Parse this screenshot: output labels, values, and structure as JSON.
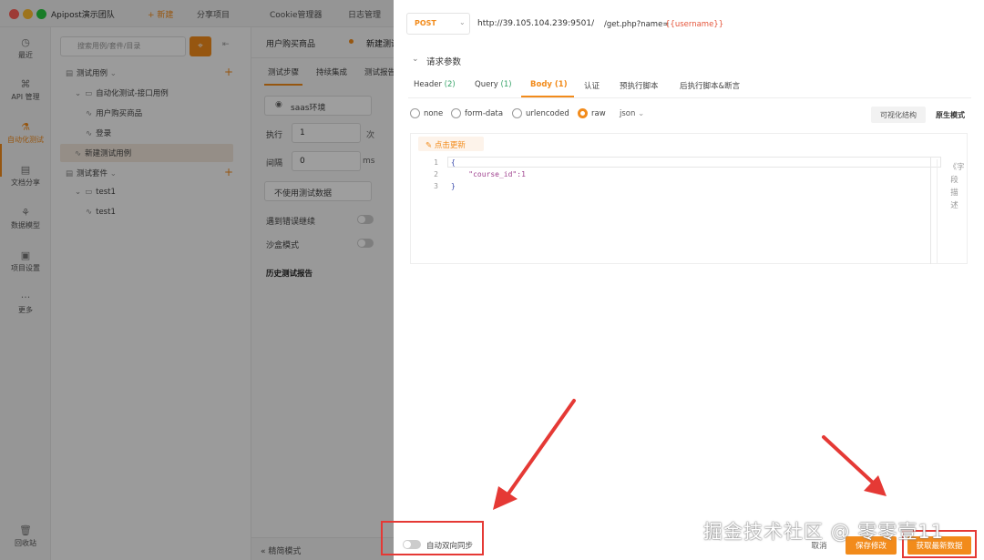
{
  "titlebar": {
    "team": "Apipost演示团队",
    "new_label": "+ 新建",
    "share_label": "分享项目",
    "cookie_label": "Cookie管理器",
    "log_label": "日志管理"
  },
  "nav": {
    "items": [
      {
        "label": "最近",
        "icon": "clock-icon"
      },
      {
        "label": "API 管理",
        "icon": "api-icon"
      },
      {
        "label": "自动化测试",
        "icon": "flask-icon"
      },
      {
        "label": "文档分享",
        "icon": "document-icon"
      },
      {
        "label": "数据模型",
        "icon": "cube-icon"
      },
      {
        "label": "项目设置",
        "icon": "settings-icon"
      },
      {
        "label": "更多",
        "icon": "more-icon"
      },
      {
        "label": "回收站",
        "icon": "trash-icon"
      }
    ]
  },
  "tree": {
    "search_placeholder": "搜索用例/套件/目录",
    "nodes": [
      {
        "label": "测试用例"
      },
      {
        "label": "自动化测试-接口用例"
      },
      {
        "label": "用户购买商品"
      },
      {
        "label": "登录"
      },
      {
        "label": "新建测试用例"
      },
      {
        "label": "测试套件"
      },
      {
        "label": "test1"
      },
      {
        "label": "test1"
      }
    ]
  },
  "mid": {
    "tab1": "用户购买商品",
    "tab2": "新建测试",
    "subtabs": [
      "测试步骤",
      "持续集成",
      "测试报告"
    ],
    "env": "saas环境",
    "exec_label": "执行",
    "exec_value": "1",
    "exec_unit": "次",
    "interval_label": "间隔",
    "interval_value": "0",
    "interval_unit": "ms",
    "nodata": "不使用测试数据",
    "continue_on_error": "遇到错误继续",
    "sandbox": "沙盒模式",
    "history": "历史测试报告",
    "precise_mode": "精简模式"
  },
  "drawer": {
    "method": "POST",
    "url_base": "http://39.105.104.239:9501/",
    "url_path": "/get.php?name=",
    "url_var": "{{username}}",
    "section_title": "请求参数",
    "tabs": [
      {
        "label": "Header",
        "count": "(2)"
      },
      {
        "label": "Query",
        "count": "(1)"
      },
      {
        "label": "Body",
        "count": "(1)"
      },
      {
        "label": "认证",
        "count": ""
      },
      {
        "label": "预执行脚本",
        "count": ""
      },
      {
        "label": "后执行脚本&断言",
        "count": ""
      }
    ],
    "body_types": [
      "none",
      "form-data",
      "urlencoded",
      "raw"
    ],
    "selected_body_type": "raw",
    "format": "json",
    "vis_struct": "可视化结构",
    "raw_mode": "原生模式",
    "refresh": "点击更新",
    "code_lines": [
      {
        "n": "1",
        "text": "{"
      },
      {
        "n": "2",
        "text": "    \"course_id\":1"
      },
      {
        "n": "3",
        "text": "}"
      }
    ],
    "field_desc": "《字段描述",
    "sync_label": "自动双向同步",
    "cancel": "取消",
    "save": "保存修改",
    "fetch": "获取最新数据"
  },
  "watermark": "掘金技术社区 @ 零零壹11",
  "colors": {
    "accent": "#f28b1b",
    "annotation_red": "#e53935",
    "count_green": "#3aa56b",
    "variable_red": "#e5553b"
  }
}
